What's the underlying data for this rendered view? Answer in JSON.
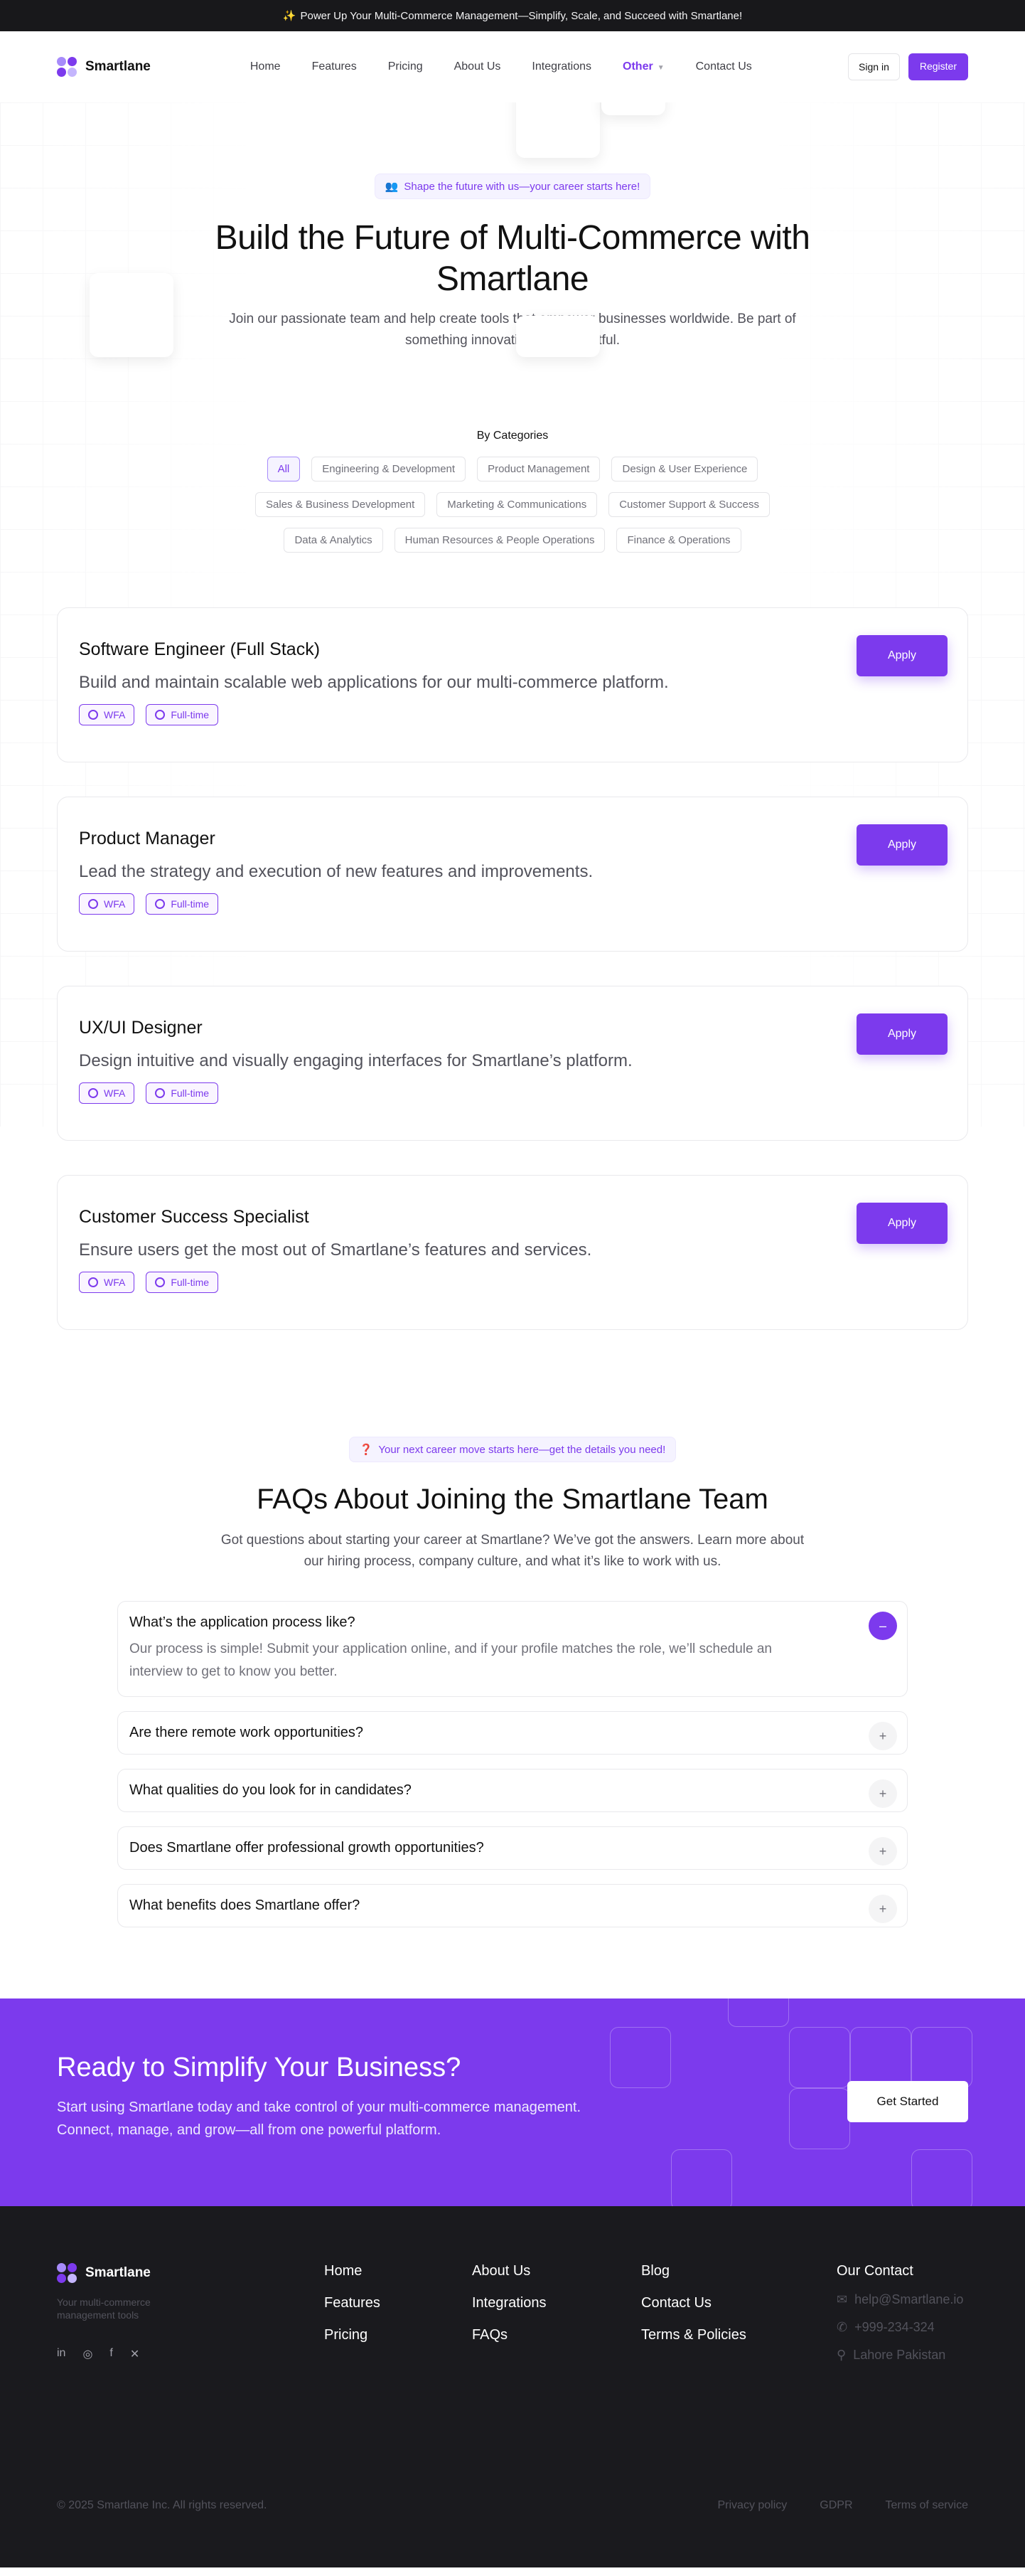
{
  "announcement": {
    "icon": "✨",
    "text": "Power Up Your Multi-Commerce Management—Simplify, Scale, and Succeed with Smartlane!"
  },
  "brand": {
    "name": "Smartlane",
    "accent": "#7c3aed"
  },
  "nav": {
    "items": [
      "Home",
      "Features",
      "Pricing",
      "About Us",
      "Integrations",
      "Other",
      "Contact Us"
    ],
    "active": "Other",
    "signin_label": "Sign in",
    "register_label": "Register"
  },
  "hero": {
    "pill": "Shape the future with us—your career starts here!",
    "title": "Build the Future of Multi-Commerce with Smartlane",
    "subtitle": "Join our passionate team and help create tools that empower businesses worldwide. Be part of something innovative and impactful."
  },
  "categories": {
    "title": "By Categories",
    "rows": [
      [
        "All",
        "Engineering & Development",
        "Product Management",
        "Design & User Experience"
      ],
      [
        "Sales & Business Development",
        "Marketing & Communications",
        "Customer Support & Success"
      ],
      [
        "Data & Analytics",
        "Human Resources & People Operations",
        "Finance & Operations"
      ]
    ],
    "active": "All"
  },
  "jobs": [
    {
      "title": "Software Engineer (Full Stack)",
      "desc": "Build and maintain scalable web applications for our multi-commerce platform.",
      "tags": [
        "WFA",
        "Full-time"
      ],
      "apply": "Apply"
    },
    {
      "title": "Product Manager",
      "desc": "Lead the strategy and execution of new features and improvements.",
      "tags": [
        "WFA",
        "Full-time"
      ],
      "apply": "Apply"
    },
    {
      "title": "UX/UI Designer",
      "desc": "Design intuitive and visually engaging interfaces for Smartlane’s platform.",
      "tags": [
        "WFA",
        "Full-time"
      ],
      "apply": "Apply"
    },
    {
      "title": "Customer Success Specialist",
      "desc": "Ensure users get the most out of Smartlane’s features and services.",
      "tags": [
        "WFA",
        "Full-time"
      ],
      "apply": "Apply"
    }
  ],
  "faq": {
    "pill": "Your next career move starts here—get the details you need!",
    "title": "FAQs About Joining the Smartlane Team",
    "subtitle": "Got questions about starting your career at Smartlane? We’ve got the answers. Learn more about our hiring process, company culture, and what it’s like to work with us.",
    "items": [
      {
        "q": "What’s the application process like?",
        "a": "Our process is simple! Submit your application online, and if your profile matches the role, we’ll schedule an interview to get to know you better.",
        "open": true
      },
      {
        "q": "Are there remote work opportunities?",
        "a": "",
        "open": false
      },
      {
        "q": "What qualities do you look for in candidates?",
        "a": "",
        "open": false
      },
      {
        "q": "Does Smartlane offer professional growth opportunities?",
        "a": "",
        "open": false
      },
      {
        "q": "What benefits does Smartlane offer?",
        "a": "",
        "open": false
      }
    ]
  },
  "cta": {
    "title": "Ready to Simplify Your Business?",
    "text": "Start using Smartlane today and take control of your multi-commerce management. Connect, manage, and grow—all from one powerful platform.",
    "button": "Get Started"
  },
  "footer": {
    "tagline": "Your multi-commerce management tools",
    "socials": [
      "linkedin-icon",
      "instagram-icon",
      "facebook-icon",
      "x-icon"
    ],
    "col1": [
      "Home",
      "Features",
      "Pricing"
    ],
    "col2": [
      "About Us",
      "Integrations",
      "FAQs"
    ],
    "col3": [
      "Blog",
      "Contact Us",
      "Terms & Policies"
    ],
    "contact_title": "Our Contact",
    "email": "help@Smartlane.io",
    "phone": "+999-234-324",
    "address": "Lahore Pakistan",
    "copyright": "© 2025 Smartlane Inc. All rights reserved.",
    "legal": [
      "Privacy policy",
      "GDPR",
      "Terms of service"
    ]
  }
}
